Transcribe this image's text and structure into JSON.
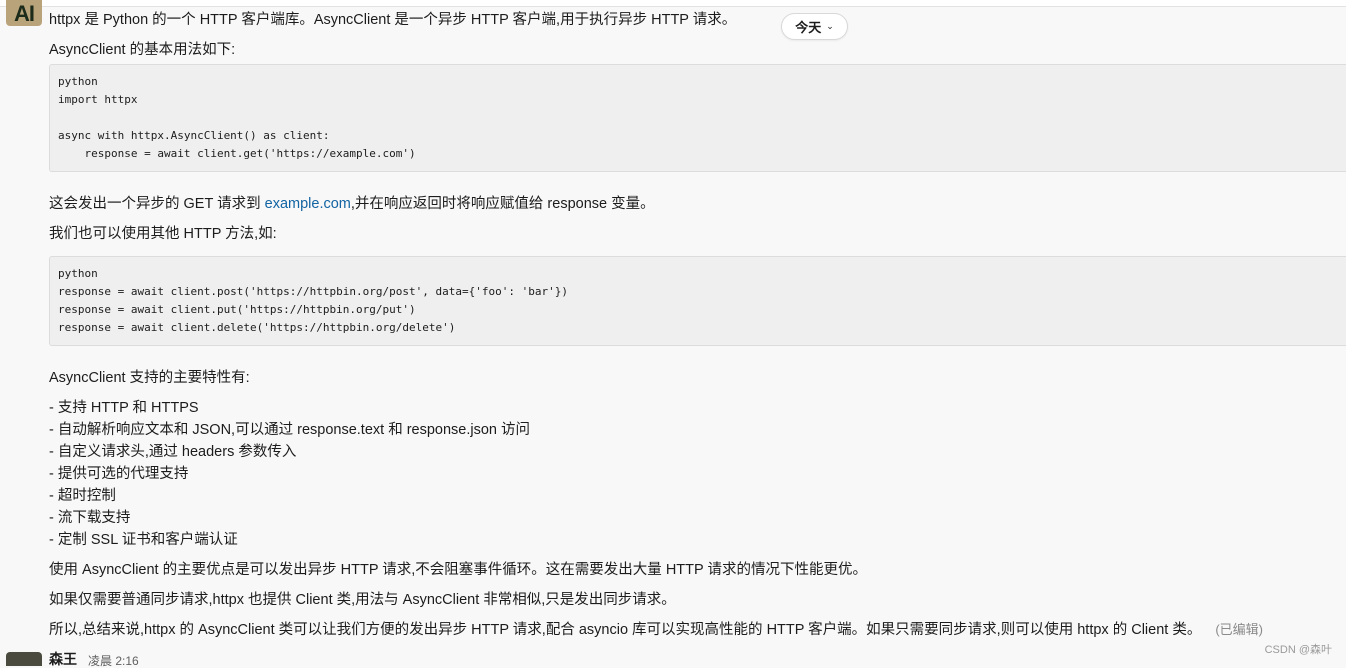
{
  "message": {
    "avatar_text": "AI",
    "intro": "httpx 是 Python 的一个 HTTP 客户端库。AsyncClient 是一个异步 HTTP 客户端,用于执行异步 HTTP 请求。",
    "basic_usage": "AsyncClient 的基本用法如下:",
    "code1": [
      "python",
      "import httpx",
      "",
      "async with httpx.AsyncClient() as client:",
      "    response = await client.get('https://example.com')"
    ],
    "get_desc_before": "这会发出一个异步的 GET 请求到 ",
    "get_desc_link": "example.com",
    "get_desc_after": ",并在响应返回时将响应赋值给 response 变量。",
    "other_methods": "我们也可以使用其他 HTTP 方法,如:",
    "code2": [
      "python",
      "response = await client.post('https://httpbin.org/post', data={'foo': 'bar'})",
      "response = await client.put('https://httpbin.org/put')",
      "response = await client.delete('https://httpbin.org/delete')"
    ],
    "features_title": "AsyncClient 支持的主要特性有:",
    "features": [
      "- 支持 HTTP 和 HTTPS",
      "- 自动解析响应文本和 JSON,可以通过 response.text 和 response.json 访问",
      "- 自定义请求头,通过 headers 参数传入",
      "- 提供可选的代理支持",
      "- 超时控制",
      "- 流下载支持",
      "- 定制 SSL 证书和客户端认证"
    ],
    "advantage": "使用 AsyncClient 的主要优点是可以发出异步 HTTP 请求,不会阻塞事件循环。这在需要发出大量 HTTP 请求的情况下性能更优。",
    "sync_note": "如果仅需要普通同步请求,httpx 也提供 Client 类,用法与 AsyncClient 非常相似,只是发出同步请求。",
    "summary": "所以,总结来说,httpx 的 AsyncClient 类可以让我们方便的发出异步 HTTP 请求,配合 asyncio 库可以实现高性能的 HTTP 客户端。如果只需要同步请求,则可以使用 httpx 的 Client 类。",
    "edited": "(已编辑)"
  },
  "date_divider": {
    "label": "今天",
    "icon": "chevron-down-icon"
  },
  "next_message": {
    "author": "森王",
    "time": "凌晨 2:16"
  },
  "watermark": "CSDN @森叶"
}
